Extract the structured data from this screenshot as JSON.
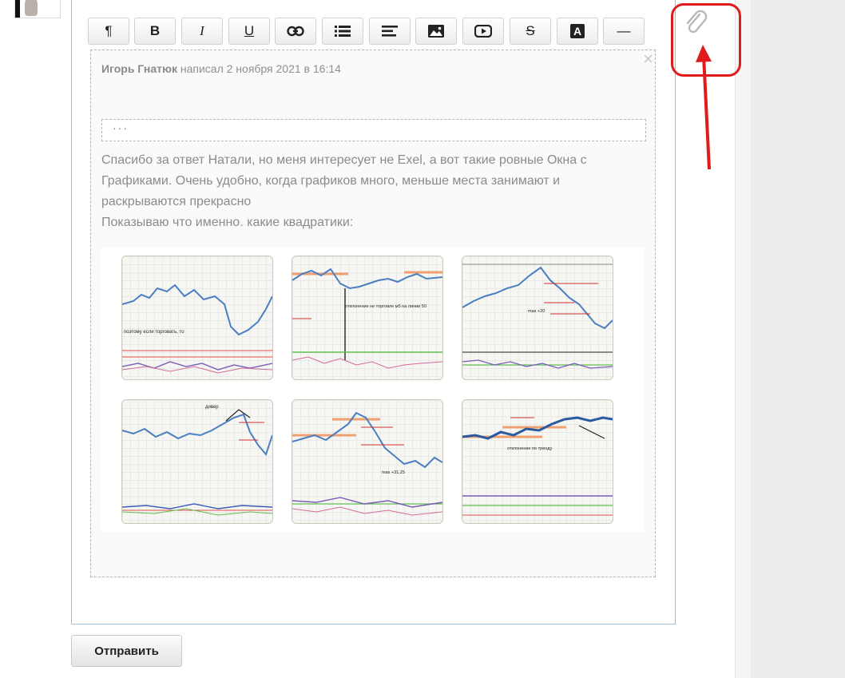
{
  "toolbar": {
    "buttons": [
      {
        "name": "paragraph-button",
        "glyph": "¶"
      },
      {
        "name": "bold-button",
        "glyph": "B"
      },
      {
        "name": "italic-button",
        "glyph": "I"
      },
      {
        "name": "underline-button",
        "glyph": "U"
      },
      {
        "name": "link-button",
        "glyph": "link-icon"
      },
      {
        "name": "list-button",
        "glyph": "list-icon"
      },
      {
        "name": "align-button",
        "glyph": "align-icon"
      },
      {
        "name": "image-button",
        "glyph": "image-icon"
      },
      {
        "name": "video-button",
        "glyph": "video-icon"
      },
      {
        "name": "strike-button",
        "glyph": "S"
      },
      {
        "name": "text-color-button",
        "glyph": "A"
      },
      {
        "name": "hr-button",
        "glyph": "—"
      }
    ]
  },
  "quote": {
    "author": "Игорь Гнатюк",
    "meta": "написал 2 ноября 2021 в 16:14",
    "close": "×",
    "spoiler_label": "···",
    "paragraph1": "Спасибо за ответ Натали, но меня интересует не Exel, а вот такие ровные Окна с Графиками. Очень удобно, когда графиков много, меньше места занимают и раскрываются прекрасно",
    "paragraph2": "Показываю что именно. какие квадратики:"
  },
  "thumbnails": [
    {
      "label": "поэтому если торговать, то"
    },
    {
      "label": "отклонение не торговле м5 на линии 50"
    },
    {
      "label": "max +20"
    },
    {
      "label": "дивер"
    },
    {
      "label": "max +31,25"
    },
    {
      "label": "отклонение по тренду"
    }
  ],
  "send_button": {
    "label": "Отправить"
  },
  "colors": {
    "annotation": "#e01b1b",
    "editor_border": "#9fc0dd",
    "chart_line": "#4a7fc1"
  }
}
